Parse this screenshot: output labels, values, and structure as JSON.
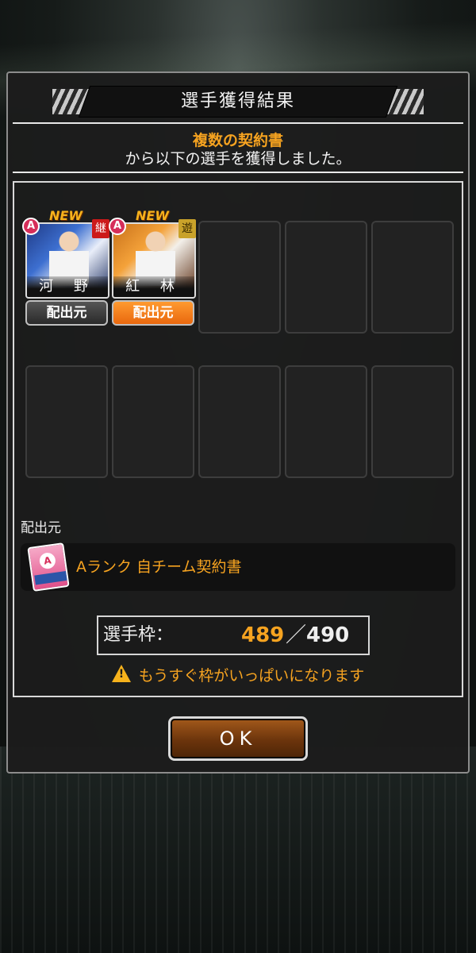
{
  "dialog": {
    "title": "選手獲得結果",
    "message_highlight": "複数の契約書",
    "message_body": "から以下の選手を獲得しました。"
  },
  "cards": [
    {
      "rank": "A",
      "new_tag": "NEW",
      "position": "継",
      "player_name": "河 野",
      "source_button": "配出元",
      "button_style": "dark"
    },
    {
      "rank": "A",
      "new_tag": "NEW",
      "position": "遊",
      "player_name": "紅 林",
      "source_button": "配出元",
      "button_style": "orange"
    }
  ],
  "empty_slots": 8,
  "source": {
    "label": "配出元",
    "contract_icon_rank": "A",
    "contract_name": "Aランク 自チーム契約書"
  },
  "capacity": {
    "label": "選手枠：",
    "current": "489",
    "separator": "／",
    "max": "490"
  },
  "warning": "もうすぐ枠がいっぱいになります",
  "ok_button": "OK",
  "colors": {
    "accent": "#f6a320",
    "rank_badge": "#d62e5a",
    "ok_button": "#6b340c"
  }
}
